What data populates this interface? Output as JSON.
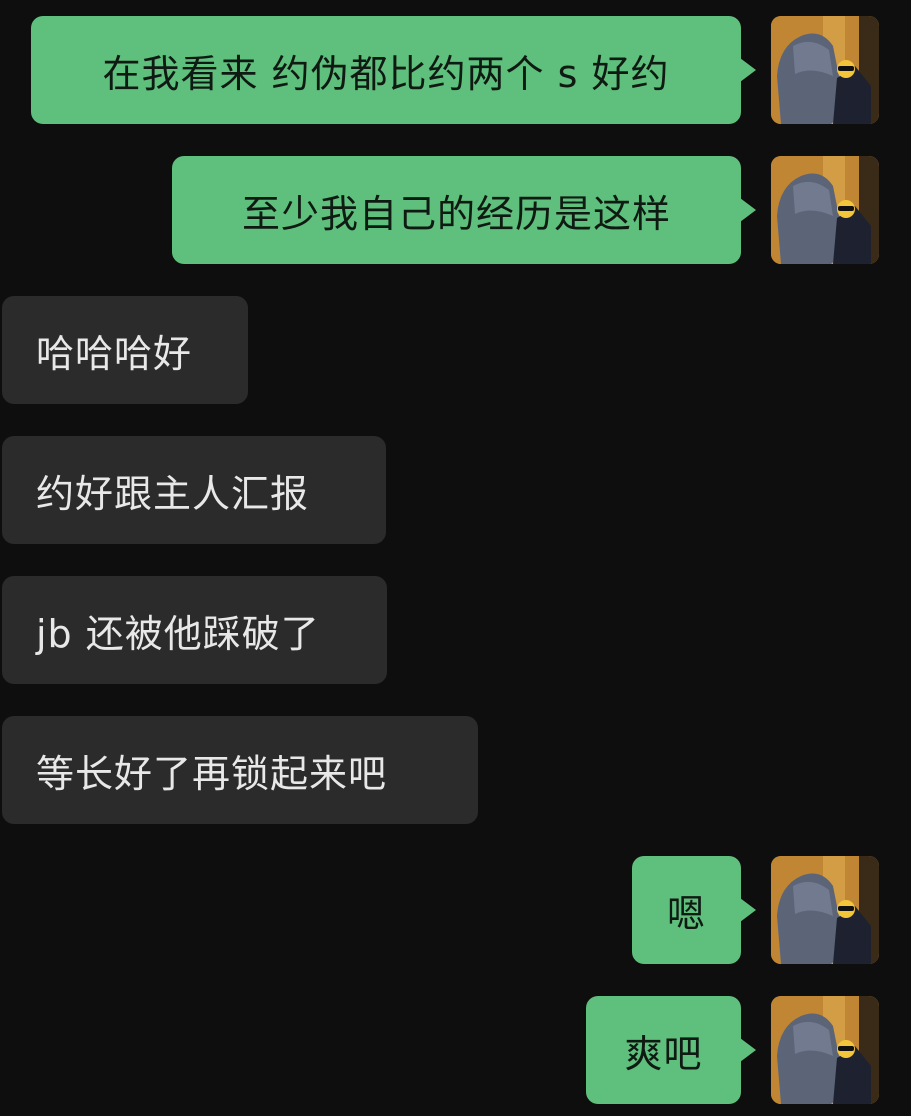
{
  "messages": [
    {
      "sender": "me",
      "text": "在我看来 约伪都比约两个 s 好约"
    },
    {
      "sender": "me",
      "text": "至少我自己的经历是这样"
    },
    {
      "sender": "them",
      "text": "哈哈哈好"
    },
    {
      "sender": "them",
      "text": "约好跟主人汇报"
    },
    {
      "sender": "them",
      "text": "jb 还被他踩破了"
    },
    {
      "sender": "them",
      "text": "等长好了再锁起来吧"
    },
    {
      "sender": "me",
      "text": "嗯"
    },
    {
      "sender": "me",
      "text": "爽吧"
    }
  ],
  "colors": {
    "background": "#0e0e0e",
    "outgoing_bubble": "#5fbf7c",
    "incoming_bubble": "#2b2b2b"
  },
  "avatar": {
    "icon": "user-avatar-photo-with-sunglasses-emoji"
  }
}
